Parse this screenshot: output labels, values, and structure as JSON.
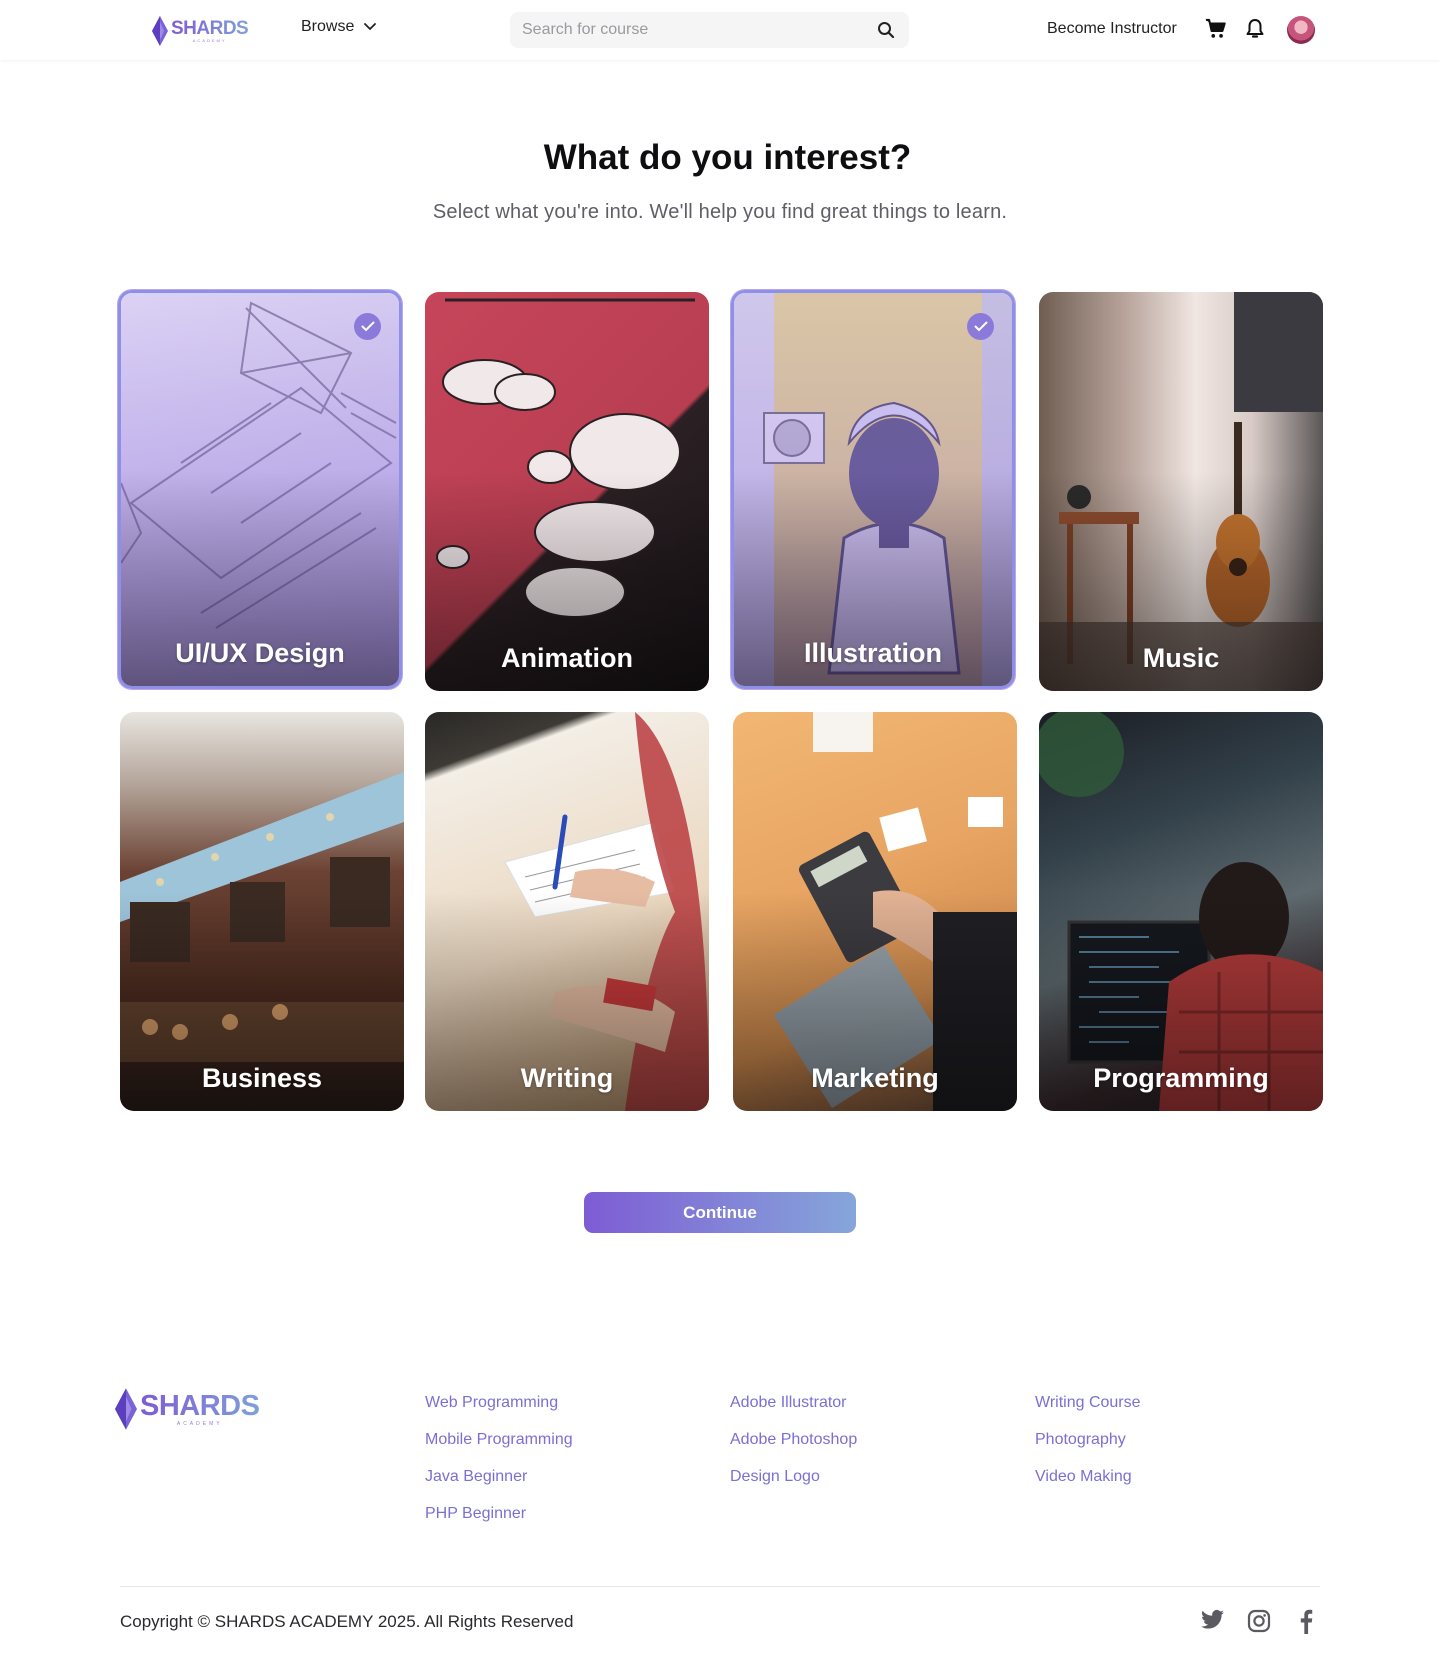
{
  "header": {
    "logo_text": "SHARDS",
    "logo_sub": "ACADEMY",
    "browse_label": "Browse",
    "search_placeholder": "Search for course",
    "become_instructor": "Become Instructor"
  },
  "hero": {
    "title": "What do you interest?",
    "subtitle": "Select what you're into. We'll help you find great things to learn."
  },
  "interests": [
    {
      "label": "UI/UX Design",
      "selected": true
    },
    {
      "label": "Animation",
      "selected": false
    },
    {
      "label": "Illustration",
      "selected": true
    },
    {
      "label": "Music",
      "selected": false
    },
    {
      "label": "Business",
      "selected": false
    },
    {
      "label": "Writing",
      "selected": false
    },
    {
      "label": "Marketing",
      "selected": false
    },
    {
      "label": "Programming",
      "selected": false
    }
  ],
  "continue_label": "Continue",
  "footer": {
    "logo_text": "SHARDS",
    "logo_sub": "ACADEMY",
    "columns": [
      [
        "Web Programming",
        "Mobile Programming",
        "Java Beginner",
        "PHP Beginner"
      ],
      [
        "Adobe Illustrator",
        "Adobe Photoshop",
        "Design Logo"
      ],
      [
        "Writing Course",
        "Photography",
        "Video Making"
      ]
    ],
    "copyright": "Copyright © SHARDS ACADEMY 2025. All Rights Reserved",
    "social": [
      "twitter-icon",
      "instagram-icon",
      "facebook-icon"
    ]
  },
  "colors": {
    "brand_start": "#7e5cd4",
    "brand_end": "#86a6da",
    "link": "#7b6fd3",
    "selected_border": "#8e8fe6"
  }
}
